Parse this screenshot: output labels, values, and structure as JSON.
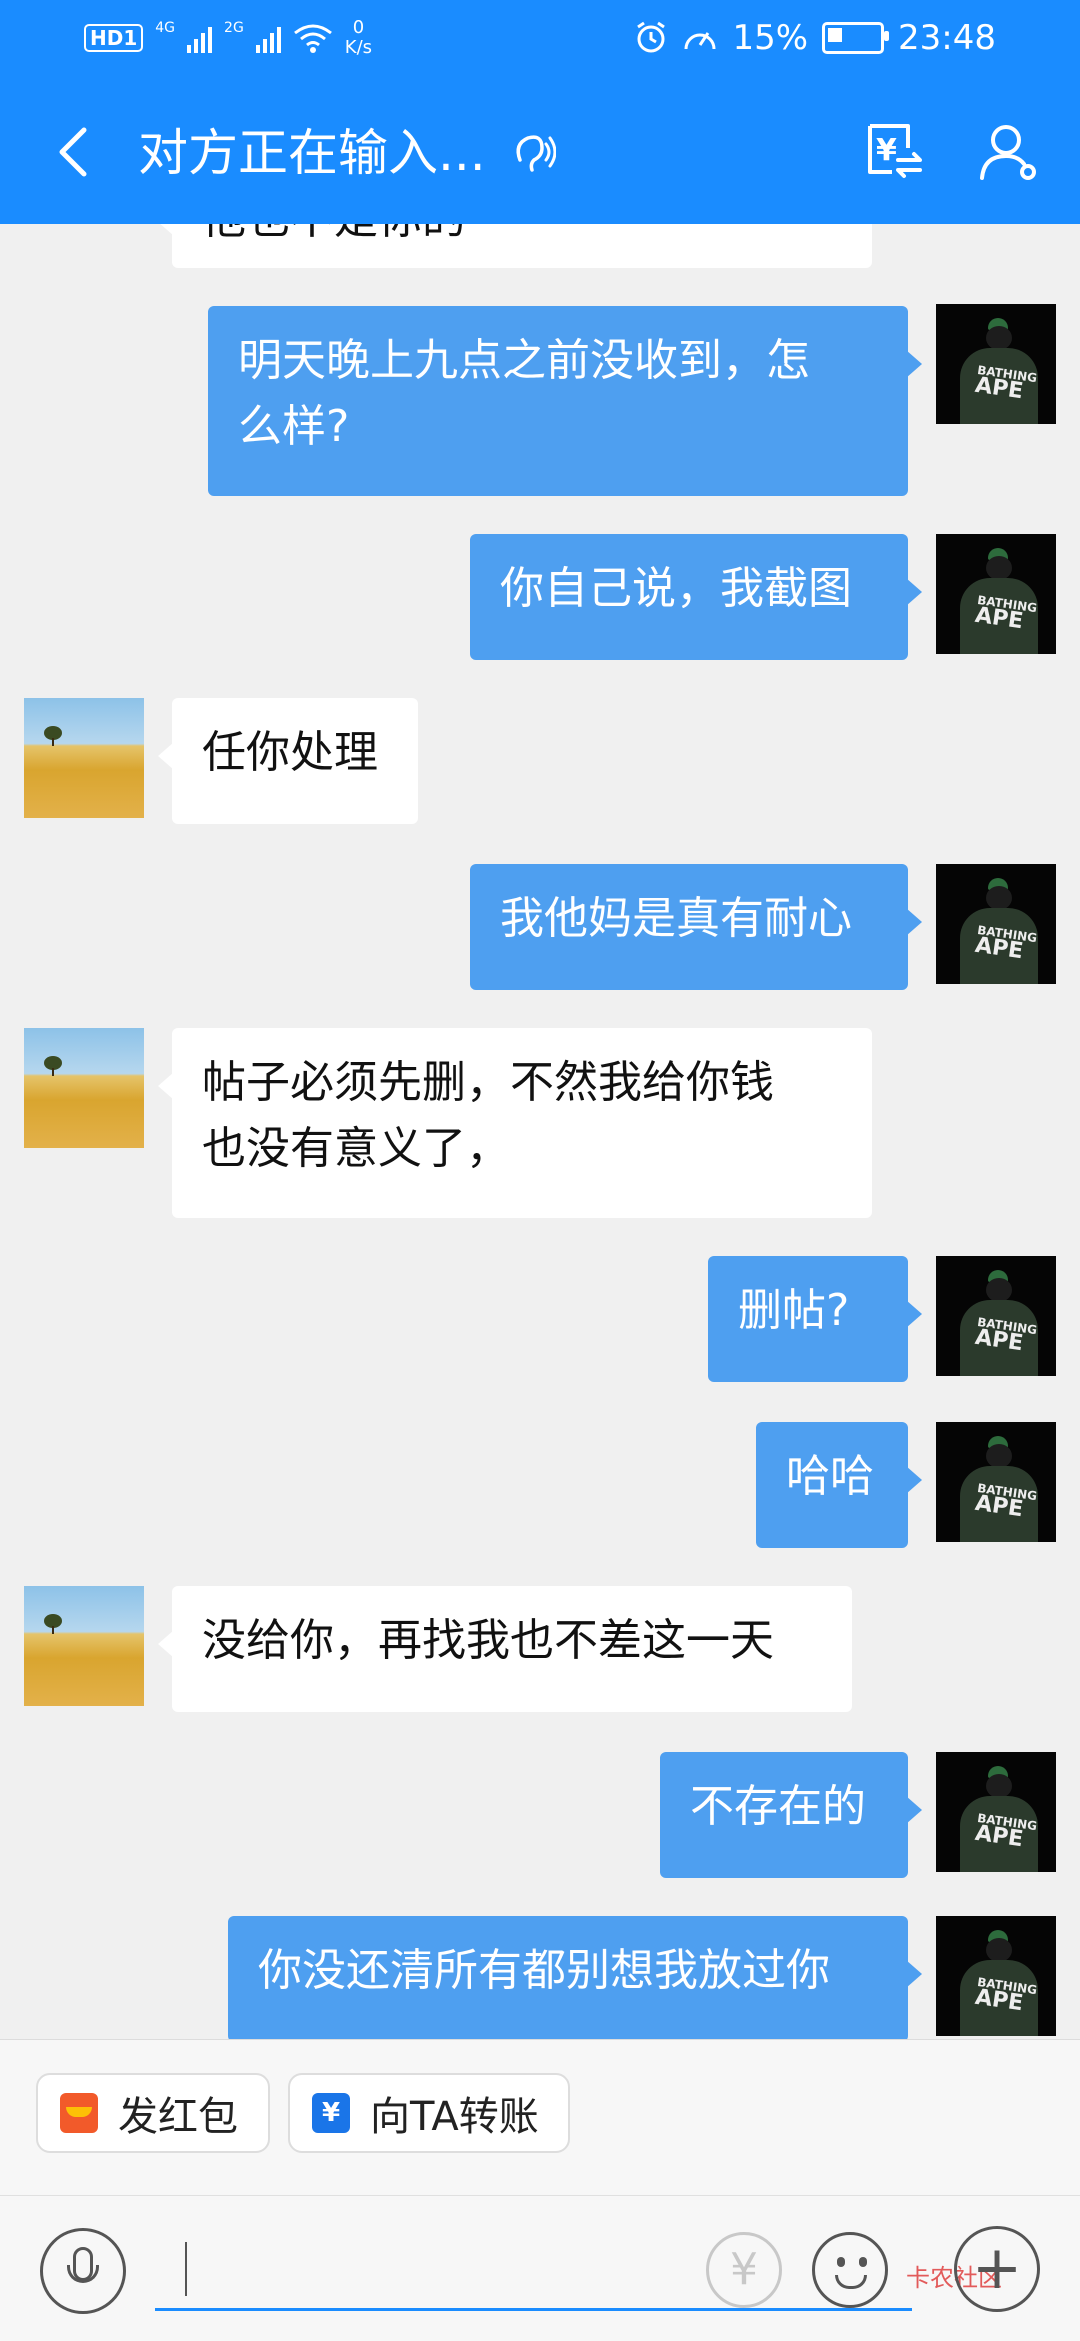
{
  "status_bar": {
    "hd_label": "HD",
    "sim_label": "1",
    "net1": "4G",
    "net2": "2G",
    "speed_value": "0",
    "speed_unit": "K/s",
    "battery": "15%",
    "time": "23:48"
  },
  "header": {
    "title": "对方正在输入...",
    "icons": [
      "back-icon",
      "ear-icon",
      "transfer-money-icon",
      "user-profile-icon"
    ]
  },
  "messages": [
    {
      "dir": "in",
      "text": "他也不是你的"
    },
    {
      "dir": "out",
      "lines": [
        "明天晚上九点之前没收到，怎",
        "么样?"
      ]
    },
    {
      "dir": "out",
      "text": "你自己说，我截图"
    },
    {
      "dir": "in",
      "text": "任你处理"
    },
    {
      "dir": "out",
      "text": "我他妈是真有耐心"
    },
    {
      "dir": "in",
      "lines": [
        "帖子必须先删，不然我给你钱",
        "也没有意义了，"
      ]
    },
    {
      "dir": "out",
      "text": "删帖?"
    },
    {
      "dir": "out",
      "text": "哈哈"
    },
    {
      "dir": "in",
      "text": "没给你，再找我也不差这一天"
    },
    {
      "dir": "out",
      "text": "不存在的"
    },
    {
      "dir": "out",
      "text": "你没还清所有都别想我放过你"
    }
  ],
  "my_avatar": {
    "line1": "BATHING",
    "line2": "APE"
  },
  "quick_actions": {
    "red_packet": "发红包",
    "transfer": "向TA转账"
  },
  "input": {
    "placeholder": ""
  },
  "icons": {
    "transfer_icon_glyph": "¥",
    "yen_button_glyph": "¥",
    "plus_glyph": "+"
  },
  "watermark": "卡农社区"
}
